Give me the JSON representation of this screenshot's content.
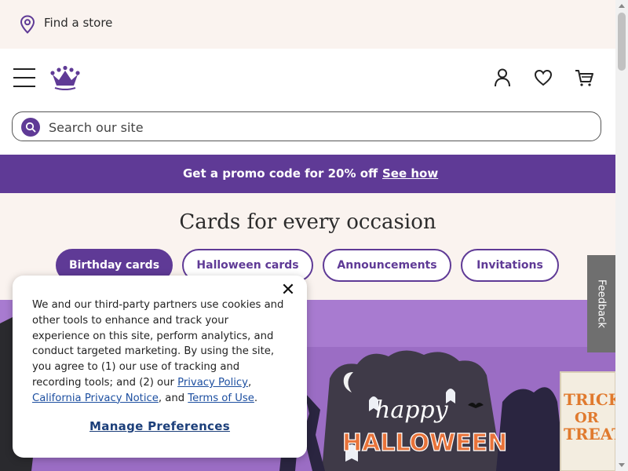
{
  "store_bar": {
    "label": "Find a store",
    "icon": "location-pin-icon"
  },
  "header": {
    "menu_icon": "hamburger-menu-icon",
    "logo_icon": "crown-logo-icon",
    "account_icon": "account-icon",
    "favorites_icon": "heart-icon",
    "cart_icon": "cart-icon"
  },
  "search": {
    "placeholder": "Search our site",
    "icon": "search-icon"
  },
  "promo": {
    "text": "Get a promo code for 20% off",
    "link": "See how"
  },
  "occasions": {
    "title": "Cards for every occasion",
    "pills": [
      {
        "label": "Birthday cards",
        "active": true
      },
      {
        "label": "Halloween cards",
        "active": false
      },
      {
        "label": "Announcements",
        "active": false
      },
      {
        "label": "Invitations",
        "active": false
      }
    ]
  },
  "hero": {
    "title_line1": "happy",
    "title_line2": "HALLOWEEN",
    "card_text_1": "TRICK",
    "card_text_2": "OR",
    "card_text_3": "TREAT"
  },
  "feedback": {
    "label": "Feedback"
  },
  "cookie": {
    "text_1": "We and our third-party partners use cookies and other tools to enhance and track your experience on this site, perform analytics, and conduct targeted marketing. By using the site, you agree to (1) our use of tracking and recording tools; and (2) our ",
    "privacy_policy": "Privacy Policy",
    "sep_1": ", ",
    "california_notice": "California Privacy Notice",
    "sep_2": ", and ",
    "terms": "Terms of Use",
    "end": ".",
    "manage": "Manage Preferences",
    "close_icon": "close-icon"
  },
  "colors": {
    "brand_purple": "#5f3a96",
    "cream": "#faf3ef",
    "hero_purple": "#9b6dc4",
    "link_blue": "#1d4fa0"
  }
}
